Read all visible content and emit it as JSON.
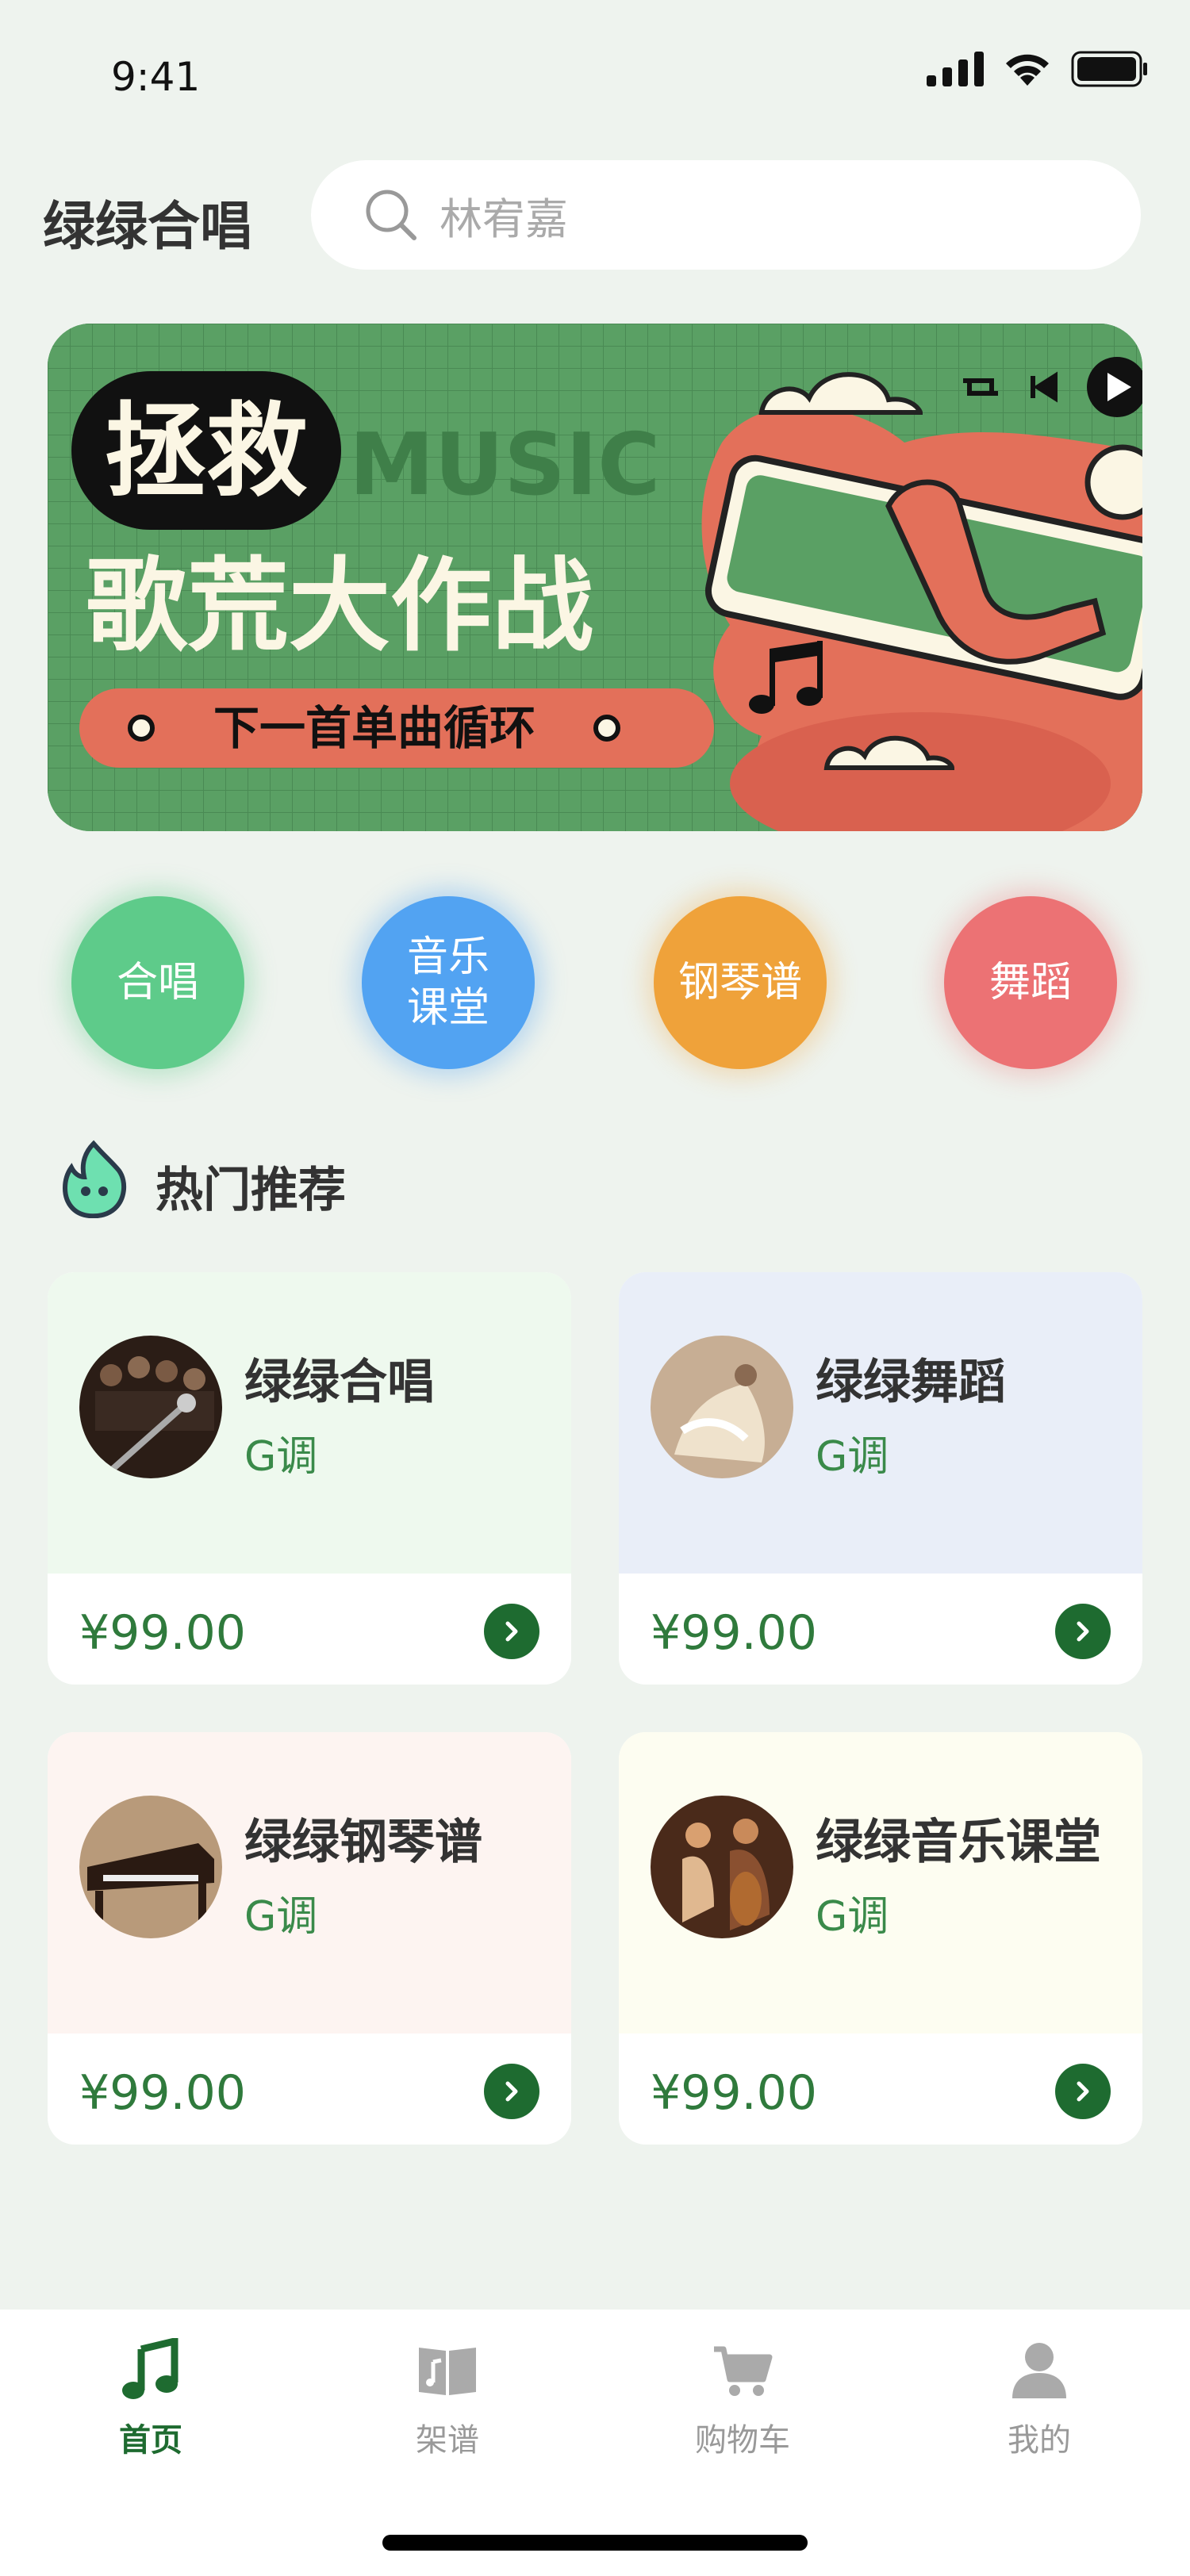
{
  "status": {
    "time": "9:41"
  },
  "header": {
    "title": "绿绿合唱",
    "search_placeholder": "林宥嘉"
  },
  "banner": {
    "badge": "拯救",
    "music": "MUSIC",
    "headline": "歌荒大作战",
    "pill": "下一首单曲循环"
  },
  "categories": [
    {
      "label_line1": "合唱",
      "label_line2": "",
      "color": "#5ecb8a"
    },
    {
      "label_line1": "音乐",
      "label_line2": "课堂",
      "color": "#52a3f2"
    },
    {
      "label_line1": "钢琴谱",
      "label_line2": "",
      "color": "#efa23a"
    },
    {
      "label_line1": "舞蹈",
      "label_line2": "",
      "color": "#ec7274"
    }
  ],
  "section": {
    "title": "热门推荐"
  },
  "products": [
    {
      "name": "绿绿合唱",
      "key": "G调",
      "price": "¥99.00",
      "bg": "#eef9ee"
    },
    {
      "name": "绿绿舞蹈",
      "key": "G调",
      "price": "¥99.00",
      "bg": "#e9eef8"
    },
    {
      "name": "绿绿钢琴谱",
      "key": "G调",
      "price": "¥99.00",
      "bg": "#fdf4f1"
    },
    {
      "name": "绿绿音乐课堂",
      "key": "G调",
      "price": "¥99.00",
      "bg": "#fdfdf1"
    }
  ],
  "tabs": [
    {
      "label": "首页",
      "icon": "music-note-icon",
      "active": true
    },
    {
      "label": "架谱",
      "icon": "book-icon",
      "active": false
    },
    {
      "label": "购物车",
      "icon": "cart-icon",
      "active": false
    },
    {
      "label": "我的",
      "icon": "user-icon",
      "active": false
    }
  ],
  "colors": {
    "accent": "#1e6b30",
    "background": "#eef3ee"
  }
}
